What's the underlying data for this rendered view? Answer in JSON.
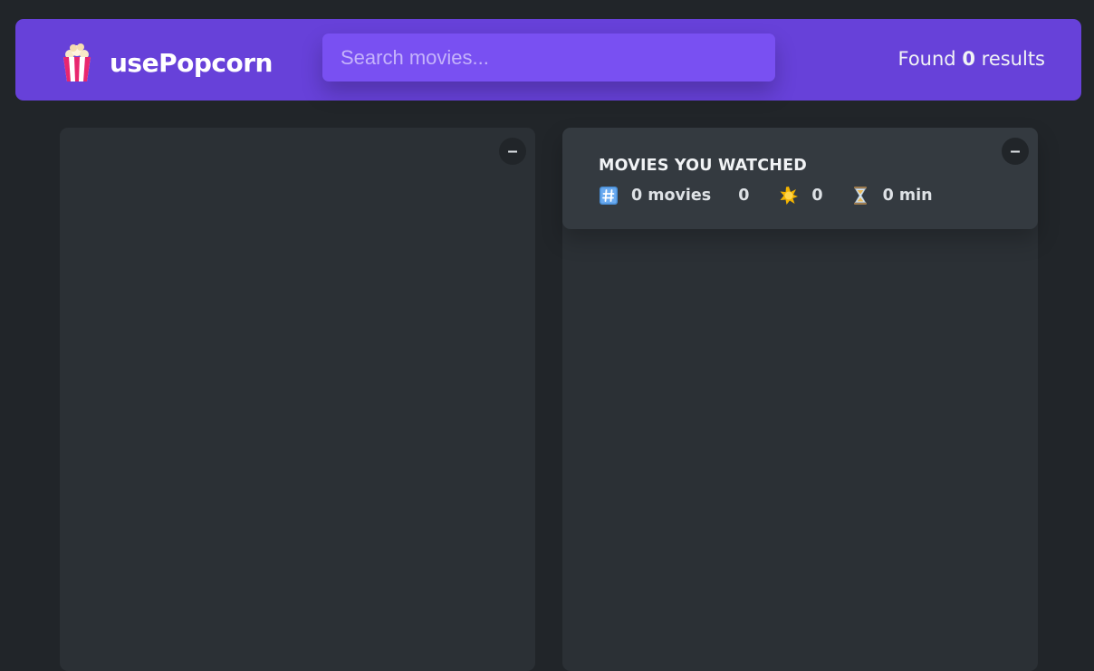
{
  "nav": {
    "logo_icon": "popcorn-icon",
    "logo_text": "usePopcorn",
    "search_placeholder": "Search movies...",
    "results_prefix": "Found",
    "results_count": "0",
    "results_suffix": "results"
  },
  "list_box": {
    "toggle_label": "–"
  },
  "watched_box": {
    "toggle_label": "–",
    "summary": {
      "title": "MOVIES YOU WATCHED",
      "movies_icon": "hash-keycap-icon",
      "movies": "0 movies",
      "imdb_rating": "0",
      "user_rating_icon": "star-burst-icon",
      "user_rating": "0",
      "runtime_icon": "hourglass-icon",
      "runtime": "0 min"
    }
  },
  "colors": {
    "background": "#212529",
    "nav": "#6741d9",
    "search": "#7950f2",
    "box": "#2b3035",
    "summary": "#343a40"
  }
}
